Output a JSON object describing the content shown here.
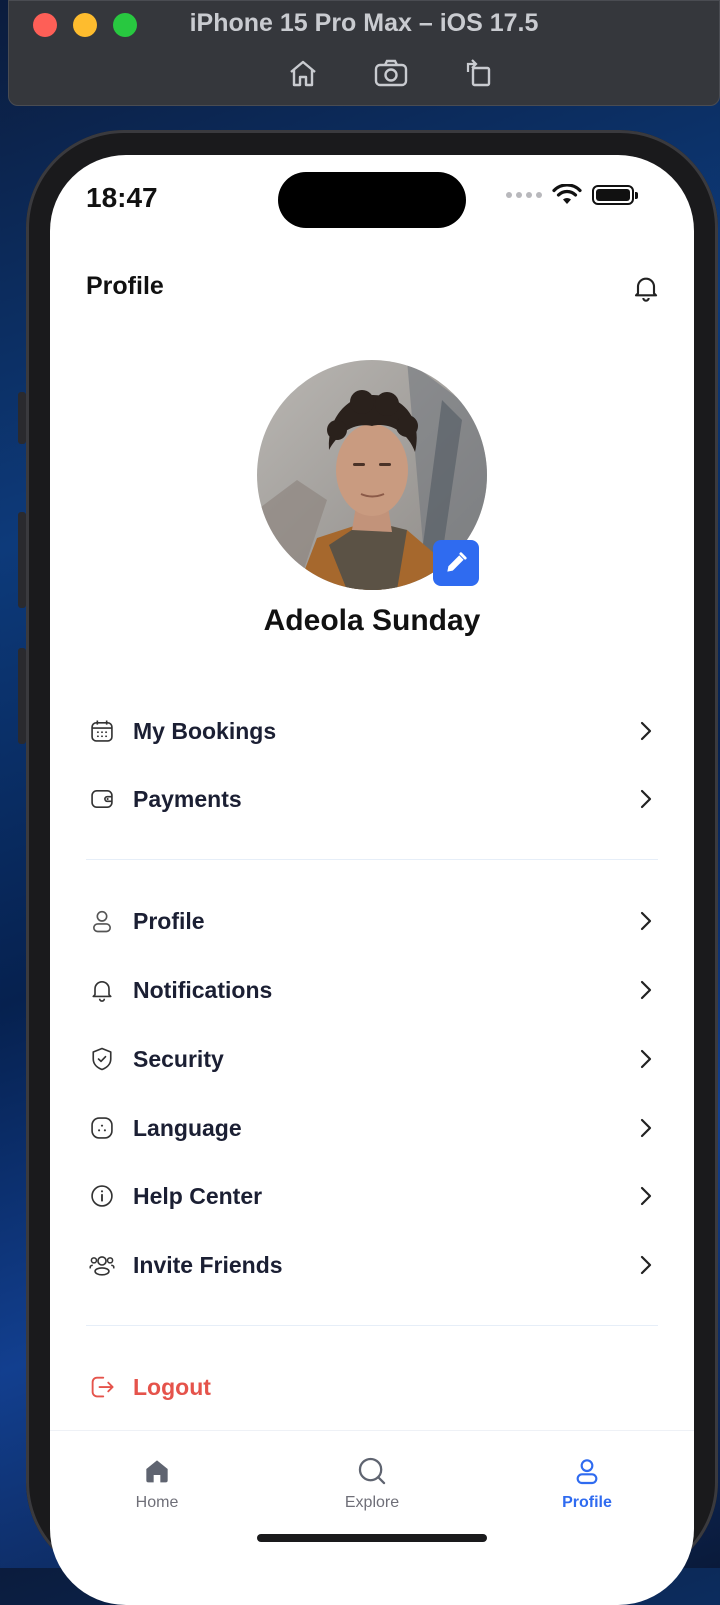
{
  "simulator": {
    "title": "iPhone 15 Pro Max – iOS 17.5",
    "tools": [
      "home-icon",
      "screenshot-icon",
      "rotate-icon"
    ]
  },
  "status_bar": {
    "time": "18:47"
  },
  "header": {
    "title": "Profile",
    "notification_icon": "bell-icon"
  },
  "profile": {
    "name": "Adeola Sunday",
    "edit_icon": "pencil-icon"
  },
  "menu_group_1": [
    {
      "label": "My Bookings",
      "icon": "calendar-icon"
    },
    {
      "label": "Payments",
      "icon": "wallet-icon"
    }
  ],
  "menu_group_2": [
    {
      "label": "Profile",
      "icon": "user-icon"
    },
    {
      "label": "Notifications",
      "icon": "bell-icon"
    },
    {
      "label": "Security",
      "icon": "shield-check-icon"
    },
    {
      "label": "Language",
      "icon": "language-icon"
    },
    {
      "label": "Help Center",
      "icon": "info-icon"
    },
    {
      "label": "Invite Friends",
      "icon": "users-icon"
    }
  ],
  "logout": {
    "label": "Logout",
    "icon": "logout-icon"
  },
  "tabbar": [
    {
      "label": "Home",
      "icon": "home-icon",
      "active": false
    },
    {
      "label": "Explore",
      "icon": "search-icon",
      "active": false
    },
    {
      "label": "Profile",
      "icon": "user-icon",
      "active": true
    }
  ],
  "colors": {
    "accent": "#2f6bf0",
    "danger": "#e5534b",
    "text": "#1b1f33",
    "muted": "#6f6f78"
  }
}
